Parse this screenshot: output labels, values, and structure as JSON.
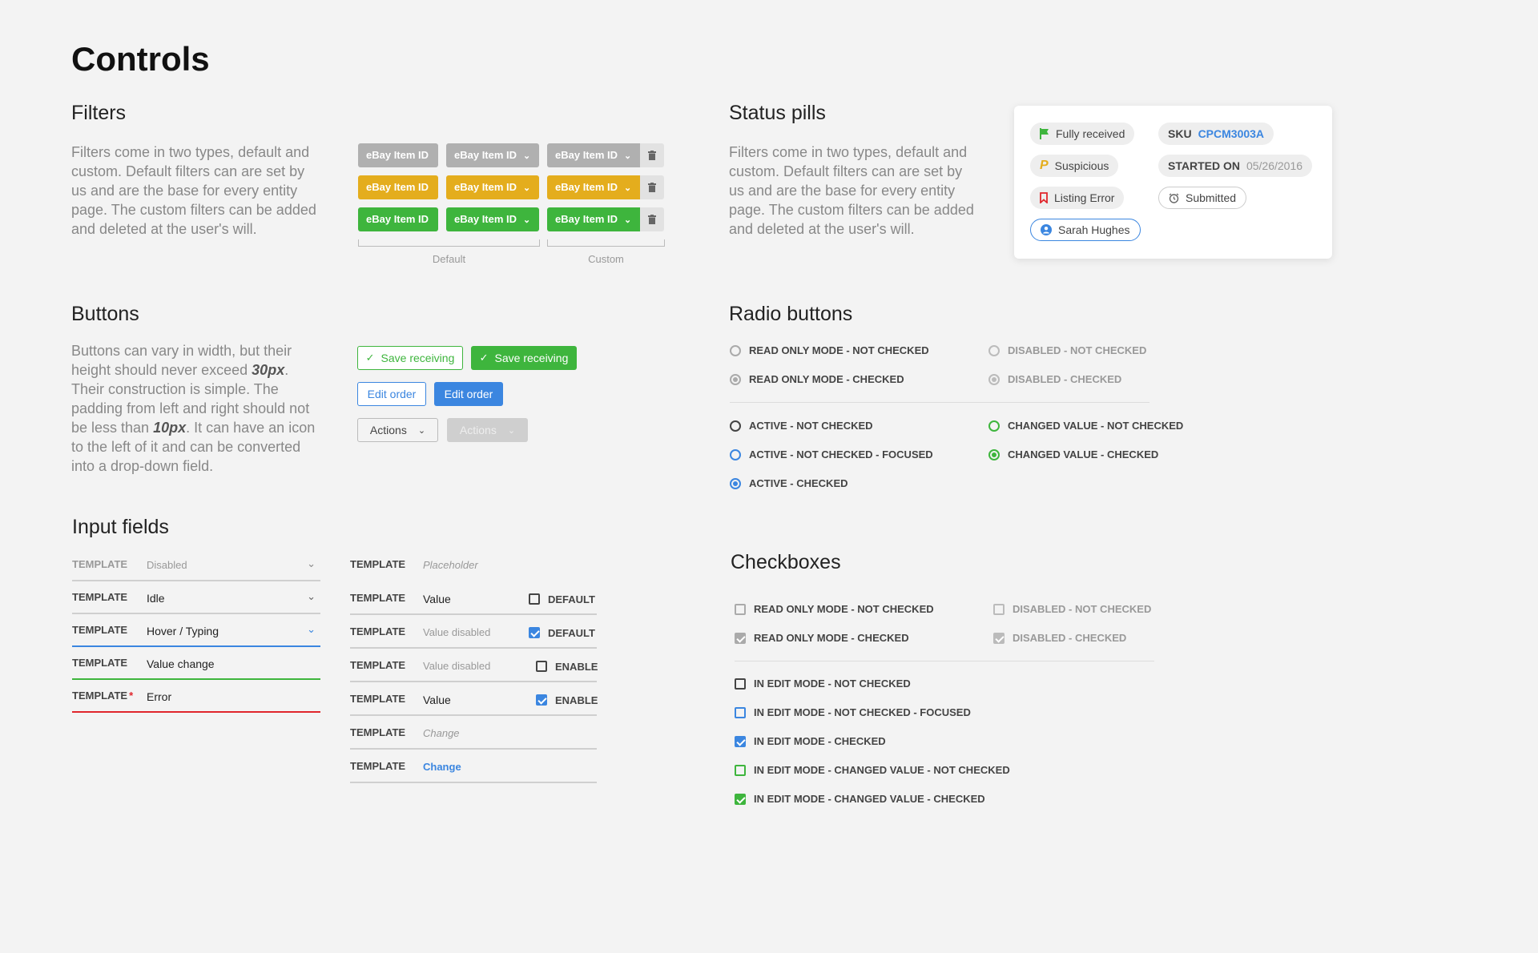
{
  "page": {
    "title": "Controls"
  },
  "filters": {
    "heading": "Filters",
    "description": "Filters come in two types, default and custom. Default filters can are set by us and are the base for every entity page. The custom filters can be added and deleted at the user's will.",
    "chip_label": "eBay Item ID",
    "default_caption": "Default",
    "custom_caption": "Custom",
    "colors": {
      "grey": "#b0b0b0",
      "yellow": "#e4ad1d",
      "green": "#3eb53d"
    }
  },
  "buttons": {
    "heading": "Buttons",
    "description_parts": [
      "Buttons can vary in width, but their height should never exceed ",
      "30px",
      ". Their construction is simple. The padding from left and right should not be less than ",
      "10px",
      ". It can have an icon to the left of it and can be converted into a drop-down field."
    ],
    "save_receiving": "Save receiving",
    "edit_order": "Edit order",
    "actions": "Actions"
  },
  "inputs": {
    "heading": "Input fields",
    "template_label": "TEMPLATE",
    "left_rows": [
      "Disabled",
      "Idle",
      "Hover / Typing",
      "Value change",
      "Error"
    ],
    "right_rows": [
      {
        "value": "Placeholder"
      },
      {
        "value": "Value",
        "check_label": "DEFAULT",
        "checked": false
      },
      {
        "value": "Value disabled",
        "check_label": "DEFAULT",
        "checked": true
      },
      {
        "value": "Value disabled",
        "check_label": "ENABLE",
        "checked": false
      },
      {
        "value": "Value",
        "check_label": "ENABLE",
        "checked": true
      },
      {
        "value": "Change"
      },
      {
        "value": "Change"
      }
    ]
  },
  "status_pills": {
    "heading": "Status pills",
    "description": "Filters come in two types, default and custom. Default filters can are set by us and are the base for every entity page. The custom filters can be added and deleted at the user's will.",
    "fully_received": "Fully received",
    "suspicious": "Suspicious",
    "listing_error": "Listing Error",
    "user": "Sarah Hughes",
    "sku_label": "SKU",
    "sku_value": "CPCM3003A",
    "started_label": "STARTED ON",
    "started_value": "05/26/2016",
    "submitted": "Submitted"
  },
  "radio_buttons": {
    "heading": "Radio buttons",
    "readonly_not_checked": "READ ONLY MODE - NOT CHECKED",
    "readonly_checked": "READ ONLY MODE - CHECKED",
    "disabled_not_checked": "DISABLED - NOT CHECKED",
    "disabled_checked": "DISABLED - CHECKED",
    "active_not_checked": "ACTIVE - NOT CHECKED",
    "active_not_checked_focused": "ACTIVE - NOT CHECKED - FOCUSED",
    "active_checked": "ACTIVE - CHECKED",
    "changed_not_checked": "CHANGED VALUE - NOT CHECKED",
    "changed_checked": "CHANGED VALUE - CHECKED"
  },
  "checkboxes": {
    "heading": "Checkboxes",
    "readonly_not_checked": "READ ONLY MODE - NOT CHECKED",
    "readonly_checked": "READ ONLY MODE  - CHECKED",
    "disabled_not_checked": "DISABLED - NOT CHECKED",
    "disabled_checked": "DISABLED - CHECKED",
    "edit_not_checked": "IN EDIT MODE - NOT CHECKED",
    "edit_not_checked_focused": "IN EDIT MODE - NOT CHECKED - FOCUSED",
    "edit_checked": "IN EDIT MODE - CHECKED",
    "edit_changed_not_checked": "IN EDIT MODE - CHANGED VALUE - NOT CHECKED",
    "edit_changed_checked": "IN EDIT MODE - CHANGED VALUE - CHECKED"
  },
  "colors": {
    "blue": "#3b86e0",
    "green": "#3eb53d",
    "red": "#e0262c",
    "yellow": "#e4ad1d"
  }
}
